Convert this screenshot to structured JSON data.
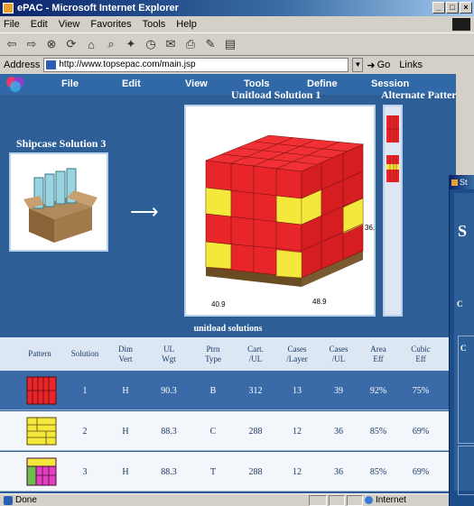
{
  "window": {
    "title": "ePAC - Microsoft Internet Explorer",
    "controls": [
      "_",
      "□",
      "×"
    ]
  },
  "menu": [
    "File",
    "Edit",
    "View",
    "Favorites",
    "Tools",
    "Help"
  ],
  "toolbar": {
    "icons": [
      "back-icon",
      "forward-icon",
      "stop-icon",
      "refresh-icon",
      "home-icon",
      "search-icon",
      "favorites-icon",
      "history-icon",
      "mail-icon",
      "print-icon",
      "edit-icon",
      "discuss-icon"
    ]
  },
  "address": {
    "label": "Address",
    "url": "http://www.topsepac.com/main.jsp",
    "go_label": "Go",
    "links_label": "Links"
  },
  "app_menu": [
    "File",
    "Edit",
    "View",
    "Tools",
    "Define",
    "Session"
  ],
  "shipcase_title": "Shipcase Solution 3",
  "unitload_title": "Unitload Solution 1",
  "alternate_title": "Alternate Patterns",
  "dimensions": {
    "left": "40.9",
    "right": "48.9",
    "height": "36."
  },
  "table": {
    "title": "unitload solutions",
    "headers": [
      [
        "Pattern",
        ""
      ],
      [
        "Solution",
        ""
      ],
      [
        "Dim",
        "Vert"
      ],
      [
        "UL",
        "Wgt"
      ],
      [
        "Ptrn",
        "Type"
      ],
      [
        "Cart.",
        "/UL"
      ],
      [
        "Cases",
        "/Layer"
      ],
      [
        "Cases",
        "/UL"
      ],
      [
        "Area",
        "Eff"
      ],
      [
        "Cubic",
        "Eff"
      ]
    ],
    "rows": [
      {
        "pattern_icon": "pattern-red-icon",
        "solution": "1",
        "dim_vert": "H",
        "ul_wgt": "90.3",
        "ptrn_type": "B",
        "cart_ul": "312",
        "cases_layer": "13",
        "cases_ul": "39",
        "area_eff": "92%",
        "cubic_eff": "75%"
      },
      {
        "pattern_icon": "pattern-yellow-icon",
        "solution": "2",
        "dim_vert": "H",
        "ul_wgt": "88.3",
        "ptrn_type": "C",
        "cart_ul": "288",
        "cases_layer": "12",
        "cases_ul": "36",
        "area_eff": "85%",
        "cubic_eff": "69%"
      },
      {
        "pattern_icon": "pattern-pink-icon",
        "solution": "3",
        "dim_vert": "H",
        "ul_wgt": "88.3",
        "ptrn_type": "T",
        "cart_ul": "288",
        "cases_layer": "12",
        "cases_ul": "36",
        "area_eff": "85%",
        "cubic_eff": "69%"
      }
    ]
  },
  "side_dialog": {
    "title": "St",
    "heading": "S",
    "labels": [
      "C",
      "C"
    ]
  },
  "status": {
    "text": "Done",
    "zone": "Internet"
  },
  "colors": {
    "app_bg": "#2d5f96",
    "selected_row": "#3a6ba8",
    "box_red": "#e8262a",
    "box_yellow": "#f4e83c",
    "pallet": "#8a6a3c"
  }
}
